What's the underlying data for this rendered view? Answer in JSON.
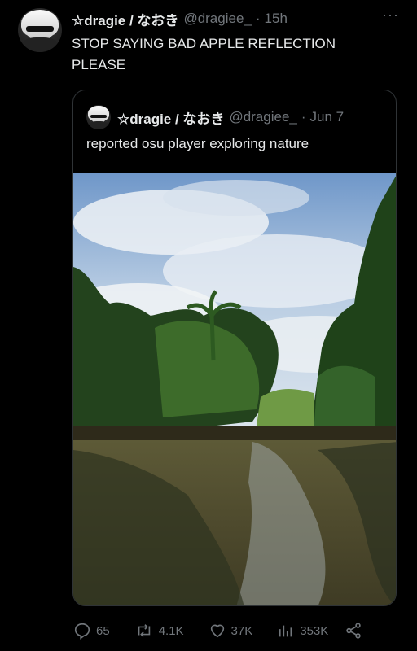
{
  "tweet": {
    "author_name": "☆dragie / なおき",
    "handle": "@dragiee_",
    "separator": "·",
    "time": "15h",
    "more": "···",
    "text_line1": "STOP SAYING BAD APPLE REFLECTION",
    "text_line2": "PLEASE"
  },
  "quote": {
    "author_name": "☆dragie / なおき",
    "handle": "@dragiee_",
    "separator": "·",
    "date": "Jun 7",
    "text": "reported osu player exploring nature"
  },
  "actions": {
    "replies": "65",
    "reposts": "4.1K",
    "likes": "37K",
    "views": "353K"
  },
  "colors": {
    "background": "#000000",
    "text": "#e7e9ea",
    "muted": "#71767b",
    "border": "#2f3336"
  }
}
